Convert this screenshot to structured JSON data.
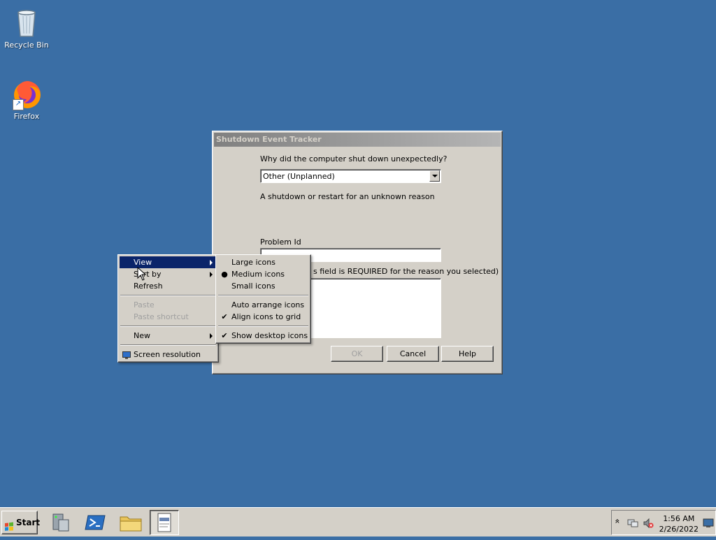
{
  "desktop": {
    "icons": [
      {
        "label": "Recycle Bin",
        "icon": "recycle-bin-icon"
      },
      {
        "label": "Firefox",
        "icon": "firefox-icon"
      }
    ],
    "background_color": "#3a6ea5"
  },
  "dialog": {
    "title": "Shutdown Event Tracker",
    "question": "Why did the computer shut down unexpectedly?",
    "reason_value": "Other (Unplanned)",
    "reason_description": "A shutdown or restart for an unknown reason",
    "problem_id_label": "Problem Id",
    "problem_id_value": "",
    "comment_label_visible": "s field is REQUIRED for the reason you selected)",
    "comment_value": "",
    "buttons": {
      "ok": "OK",
      "cancel": "Cancel",
      "help": "Help"
    }
  },
  "context_menu": {
    "items": [
      {
        "label": "View",
        "submenu": true,
        "selected": true
      },
      {
        "label": "Sort by",
        "submenu": true
      },
      {
        "label": "Refresh"
      },
      {
        "label": "Paste",
        "disabled": true
      },
      {
        "label": "Paste shortcut",
        "disabled": true
      },
      {
        "label": "New",
        "submenu": true
      },
      {
        "label": "Screen resolution",
        "icon": "display-icon"
      }
    ]
  },
  "view_submenu": {
    "items": [
      {
        "label": "Large icons"
      },
      {
        "label": "Medium icons",
        "mark": "●"
      },
      {
        "label": "Small icons"
      },
      {
        "label": "Auto arrange icons"
      },
      {
        "label": "Align icons to grid",
        "mark": "✔"
      },
      {
        "label": "Show desktop icons",
        "mark": "✔"
      }
    ]
  },
  "taskbar": {
    "start_label": "Start",
    "clock_time": "1:56 AM",
    "clock_date": "2/26/2022",
    "tray_expand": "»"
  },
  "colors": {
    "menu_highlight": "#0a246a",
    "dialog_face": "#d4d0c8"
  }
}
